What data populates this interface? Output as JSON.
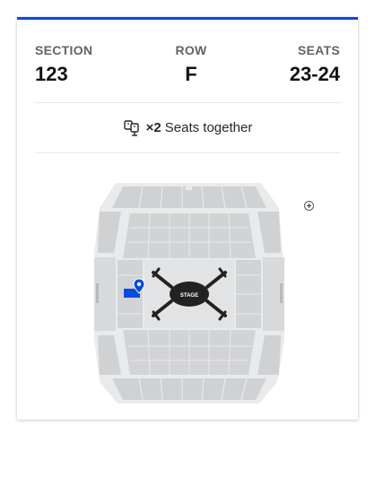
{
  "ticket": {
    "section_label": "SECTION",
    "section_value": "123",
    "row_label": "ROW",
    "row_value": "F",
    "seats_label": "SEATS",
    "seats_value": "23-24"
  },
  "seats_together": {
    "count": "×2",
    "text": "Seats together",
    "icon": "seats-icon"
  },
  "map": {
    "stage_label": "STAGE",
    "selected_section": "123",
    "accent_color": "#024ddf",
    "seat_block_color": "#cfd1d3",
    "concourse_color": "#e9eaeb",
    "floor_color": "#e2e3e4"
  }
}
